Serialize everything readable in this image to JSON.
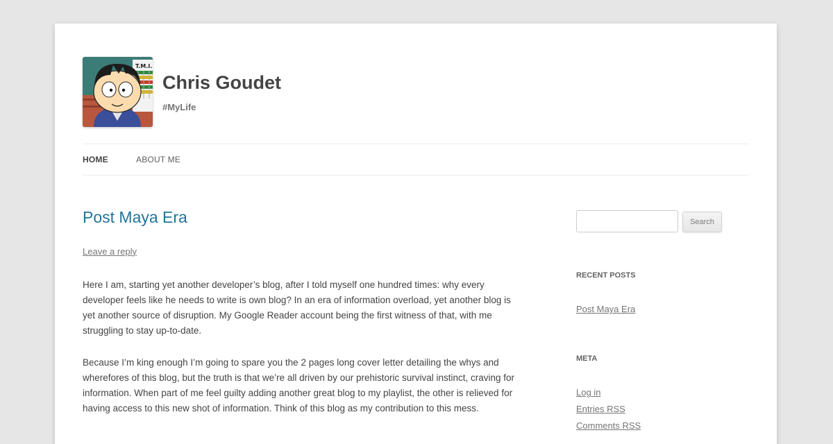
{
  "header": {
    "site_title": "Chris Goudet",
    "site_description": "#MyLife"
  },
  "nav": {
    "items": [
      {
        "label": "HOME",
        "current": true
      },
      {
        "label": "ABOUT ME",
        "current": false
      }
    ]
  },
  "post": {
    "title": "Post Maya Era",
    "comments_link": "Leave a reply",
    "paragraphs": [
      "Here I am, starting yet another developer’s blog, after I told myself one hundred times: why every developer feels like he needs to write is own blog? In an era of information overload, yet another blog is yet another source of disruption. My Google Reader account being the first witness of that, with me struggling to stay up-to-date.",
      "Because I’m king enough I’m going to spare you the 2 pages long cover letter detailing the whys and wherefores of this blog, but the truth is that we’re all driven by our prehistoric survival instinct, craving for information. When part of me feel guilty adding another great blog to my playlist, the other is relieved for having access to this new shot of information. Think of this blog as my contribution to this mess."
    ]
  },
  "sidebar": {
    "search": {
      "value": "",
      "button_label": "Search"
    },
    "recent_posts": {
      "title": "RECENT POSTS",
      "items": [
        "Post Maya Era"
      ]
    },
    "meta": {
      "title": "META",
      "items": [
        "Log in",
        "Entries RSS",
        "Comments RSS"
      ]
    }
  },
  "avatar": {
    "label": "T.M.I."
  },
  "colors": {
    "link": "#21759b",
    "background": "#e6e6e6",
    "text": "#444444"
  }
}
